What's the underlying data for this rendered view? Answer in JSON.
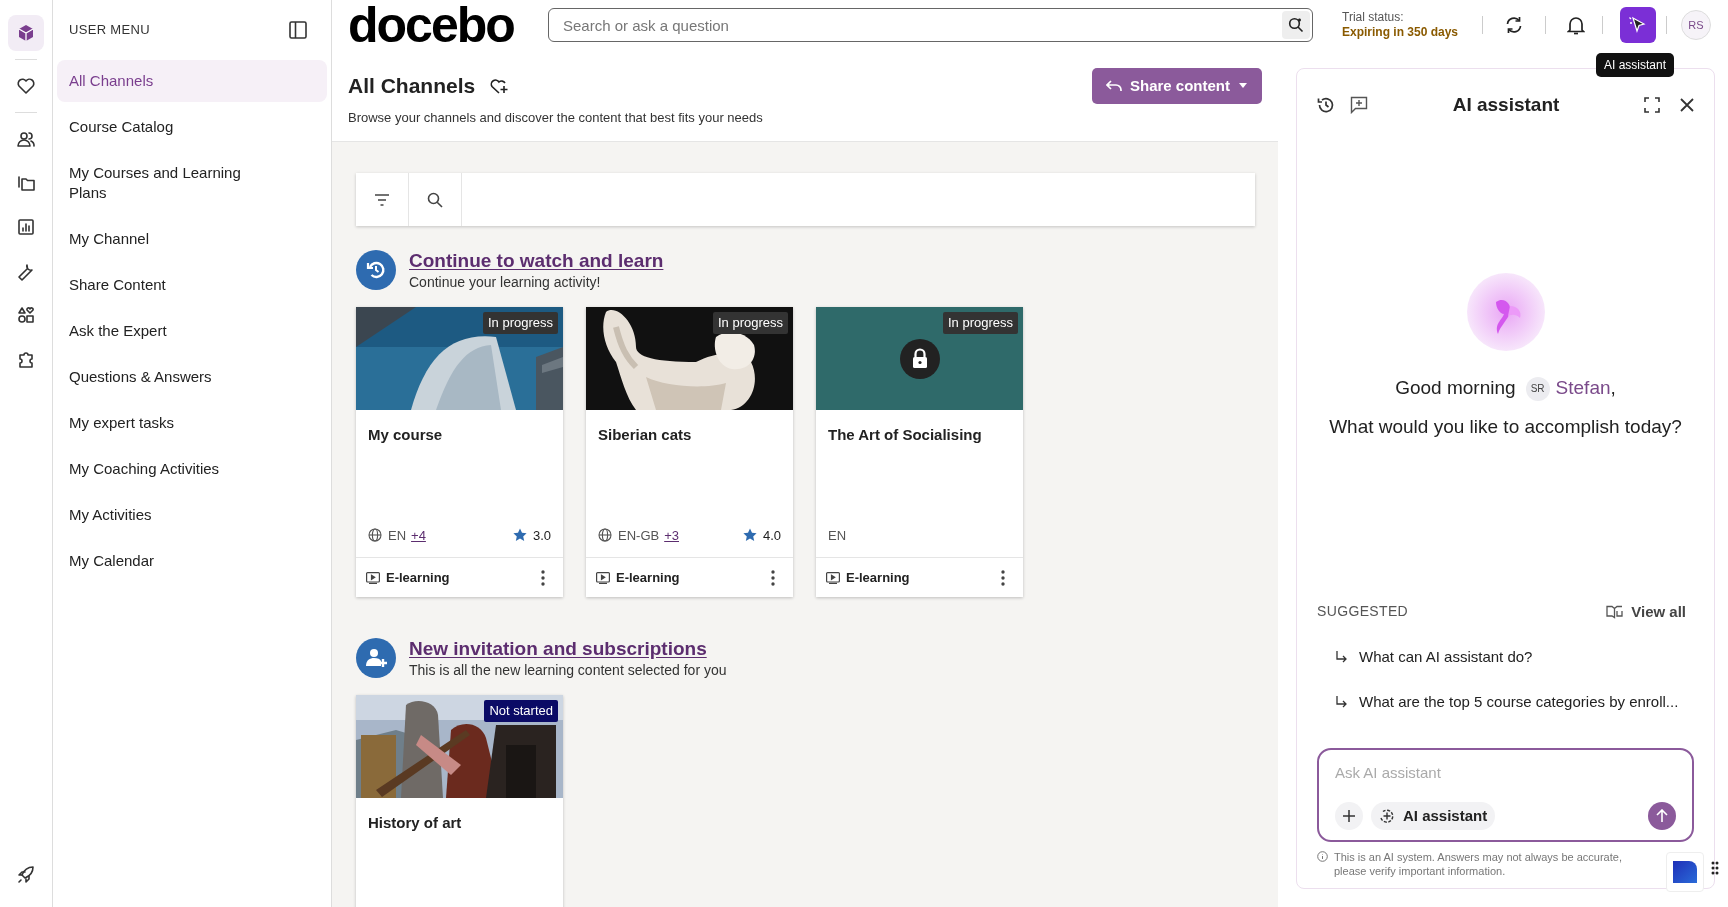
{
  "icon_rail": [
    {
      "selected": true
    },
    {
      "selected": false
    },
    {
      "selected": false
    },
    {
      "selected": false
    },
    {
      "selected": false
    },
    {
      "selected": false
    },
    {
      "selected": false
    },
    {
      "selected": false
    },
    {
      "selected": false
    }
  ],
  "user_menu": {
    "title": "USER MENU",
    "items": [
      {
        "label": "All Channels",
        "selected": true
      },
      {
        "label": "Course Catalog",
        "selected": false
      },
      {
        "label": "My Courses and Learning Plans",
        "selected": false
      },
      {
        "label": "My Channel",
        "selected": false
      },
      {
        "label": "Share Content",
        "selected": false
      },
      {
        "label": "Ask the Expert",
        "selected": false
      },
      {
        "label": "Questions & Answers",
        "selected": false
      },
      {
        "label": "My expert tasks",
        "selected": false
      },
      {
        "label": "My Coaching Activities",
        "selected": false
      },
      {
        "label": "My Activities",
        "selected": false
      },
      {
        "label": "My Calendar",
        "selected": false
      }
    ]
  },
  "header": {
    "logo": "docebo",
    "search": {
      "placeholder": "Search or ask a question"
    },
    "trial_label": "Trial status:",
    "trial_value": "Expiring in 350 days",
    "ai_button": {
      "selected": true
    },
    "avatar": "RS",
    "tooltip": "AI assistant"
  },
  "page": {
    "title": "All Channels",
    "subtitle": "Browse your channels and discover the content that best fits your needs",
    "share_button": "Share content"
  },
  "sections": [
    {
      "kind": "history",
      "title": "Continue to watch and learn",
      "subtitle": "Continue your learning activity!",
      "cards": [
        {
          "kind": "picture",
          "badge": {
            "label": "In progress",
            "color": "#333333"
          },
          "title": "My course",
          "language": "EN",
          "extra_languages": "+4",
          "rating": "3.0",
          "type": "E-learning"
        },
        {
          "kind": "picture",
          "badge": {
            "label": "In progress",
            "color": "#333333"
          },
          "title": "Siberian cats",
          "language": "EN-GB",
          "extra_languages": "+3",
          "rating": "4.0",
          "type": "E-learning"
        },
        {
          "kind": "locked",
          "badge": {
            "label": "In progress",
            "color": "#333333"
          },
          "title": "The Art of Socialising",
          "language": "EN",
          "type": "E-learning"
        }
      ]
    },
    {
      "kind": "invitation",
      "title": "New invitation and subscriptions",
      "subtitle": "This is all the new learning content selected for you",
      "cards": [
        {
          "kind": "picture",
          "badge": {
            "label": "Not started",
            "color": "#0b0b66"
          },
          "title": "History of art"
        }
      ]
    }
  ],
  "ai_panel": {
    "title": "AI assistant",
    "greeting": "Good morning",
    "user_initials": "SR",
    "user_name": "Stefan",
    "greeting_end": ",",
    "question": "What would you like to accomplish today?",
    "suggested_label": "SUGGESTED",
    "view_all": "View all",
    "suggestions": [
      "What can AI assistant do?",
      "What are the top 5 course categories by enroll..."
    ],
    "input": {
      "placeholder": "Ask AI assistant"
    },
    "mode_chip": "AI assistant",
    "disclaimer": "This is an AI system. Answers may not always be accurate, please verify important information."
  }
}
